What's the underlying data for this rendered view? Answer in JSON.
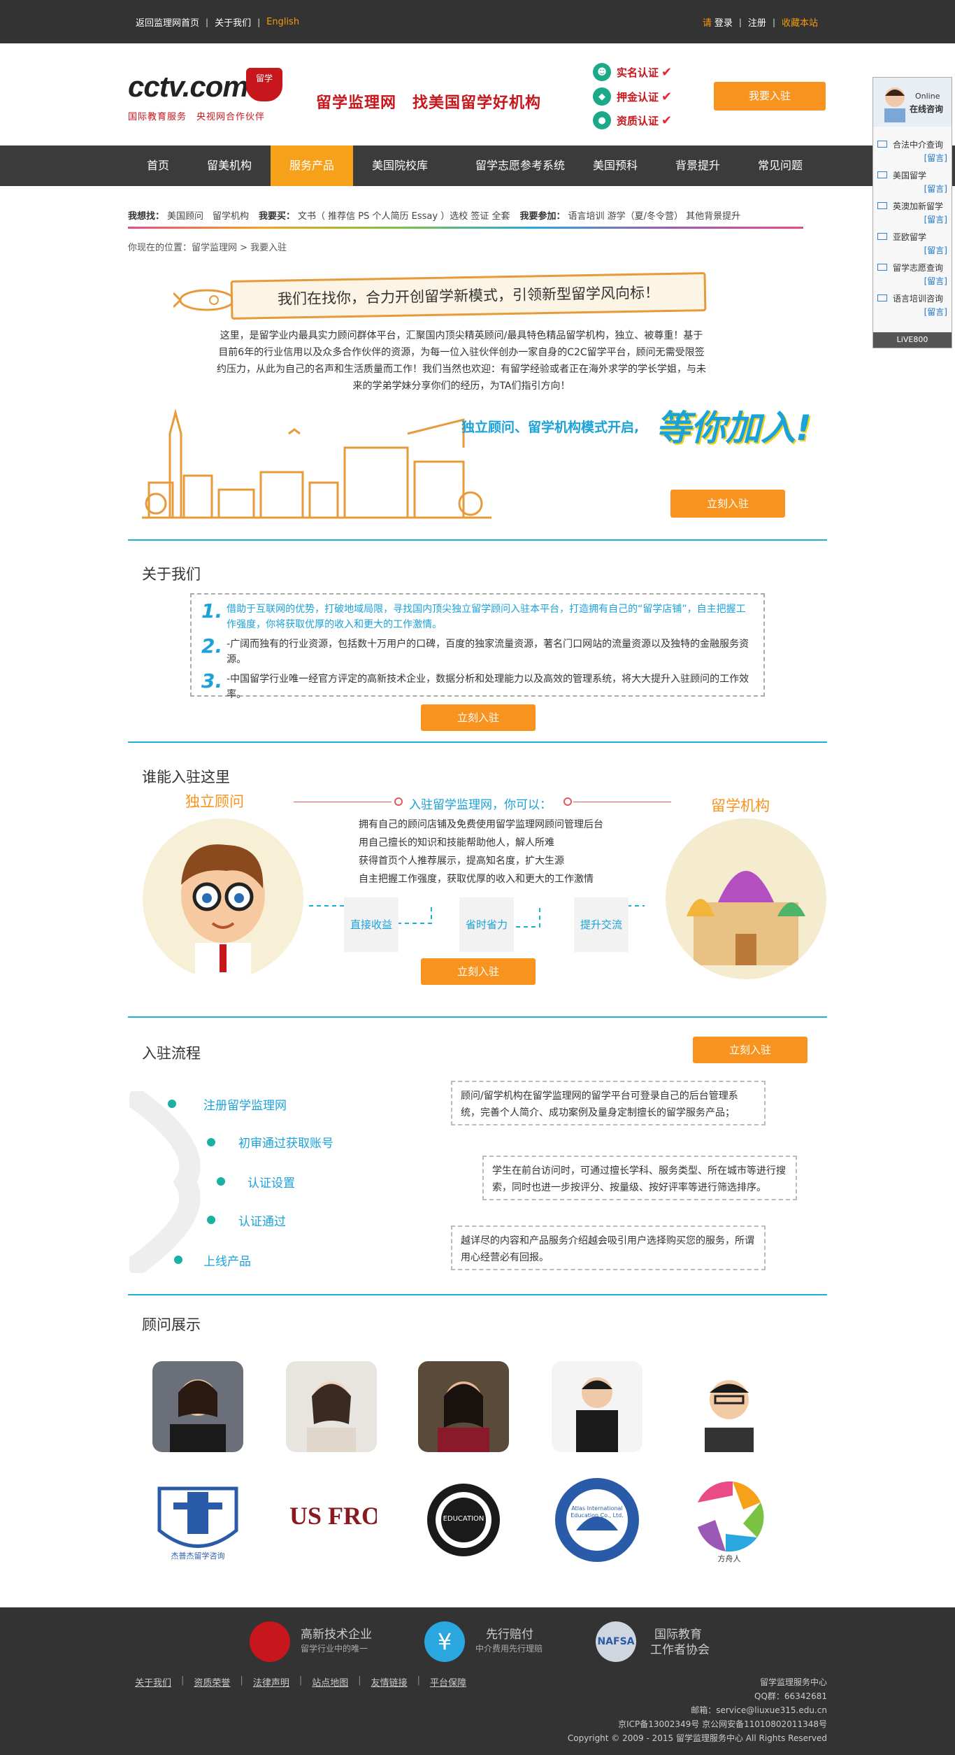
{
  "topbar": {
    "home_link": "返回监理网首页",
    "about_link": "关于我们",
    "english_link": "English",
    "please": "请",
    "login": "登录",
    "register": "注册",
    "bookmark": "收藏本站"
  },
  "header": {
    "logo_text": "cctv.com",
    "logo_sub": "国际教育服务　央视网合作伙伴",
    "badge_text": "留学",
    "slogan": "留学监理网　找美国留学好机构",
    "certs": [
      "实名认证",
      "押金认证",
      "资质认证"
    ],
    "join_button": "我要入驻"
  },
  "nav": {
    "items": [
      "首页",
      "留美机构",
      "服务产品",
      "美国院校库",
      "留学志愿参考系统",
      "美国预科",
      "背景提升",
      "常见问题"
    ]
  },
  "search": {
    "find_label": "我想找：",
    "find_values": "美国顾问　留学机构",
    "buy_label": "我要买：",
    "buy_values": "文书（ 推荐信  PS  个人简历  Essay ）选校  签证  全套",
    "join_label": "我要参加：",
    "join_values": "语言培训  游学（夏/冬令营） 其他背景提升"
  },
  "breadcrumb": "你现在的位置：留学监理网 > 我要入驻",
  "hero": {
    "banner_text": "我们在找你，合力开创留学新模式，引领新型留学风向标！",
    "intro": "这里，是留学业内最具实力顾问群体平台，汇聚国内顶尖精英顾问/最具特色精品留学机构，独立、被尊重！基于目前6年的行业信用以及众多合作伙伴的资源，为每一位入驻伙伴创办一家自身的C2C留学平台，顾问无需受限签约压力，从此为自己的名声和生活质量而工作！我们当然也欢迎：有留学经验或者正在海外求学的学长学姐，与未来的学弟学妹分享你们的经历，为TA们指引方向！",
    "slogan": "独立顾问、留学机构模式开启,",
    "big": "等你加入!",
    "join_button": "立刻入驻"
  },
  "about": {
    "title": "关于我们",
    "items": [
      {
        "num": "1.",
        "text": "借助于互联网的优势，打破地域局限，寻找国内顶尖独立留学顾问入驻本平台，打造拥有自己的“留学店铺”，自主把握工作强度，你将获取优厚的收入和更大的工作激情。"
      },
      {
        "num": "2.",
        "text": "-广阔而独有的行业资源，包括数十万用户的口碑，百度的独家流量资源，著名门口网站的流量资源以及独特的金融服务资源。"
      },
      {
        "num": "3.",
        "text": "-中国留学行业唯一经官方评定的高新技术企业，数据分析和处理能力以及高效的管理系统，将大大提升入驻顾问的工作效率。"
      }
    ],
    "join_button": "立刻入驻"
  },
  "who": {
    "title": "谁能入驻这里",
    "left_label": "独立顾问",
    "right_label": "留学机构",
    "mid_title": "入驻留学监理网，你可以：",
    "list": [
      "拥有自己的顾问店铺及免费使用留学监理网顾问管理后台",
      "用自己擅长的知识和技能帮助他人，解人所难",
      "获得首页个人推荐展示，提高知名度，扩大生源",
      "自主把握工作强度，获取优厚的收入和更大的工作激情"
    ],
    "benefits": [
      "直接收益",
      "省时省力",
      "提升交流"
    ],
    "join_button": "立刻入驻"
  },
  "flow": {
    "title": "入驻流程",
    "join_button": "立刻入驻",
    "steps": [
      "注册留学监理网",
      "初审通过获取账号",
      "认证设置",
      "认证通过",
      "上线产品"
    ],
    "boxes": [
      "顾问/留学机构在留学监理网的留学平台可登录自己的后台管理系统，完善个人简介、成功案例及量身定制擅长的留学服务产品；",
      "学生在前台访问时，可通过擅长学科、服务类型、所在城市等进行搜索，同时也进一步按评分、按量级、按好评率等进行筛选排序。",
      "越详尽的内容和产品服务介绍越会吸引用户选择购买您的服务，所谓用心经营必有回报。"
    ]
  },
  "advisors": {
    "title": "顾问展示",
    "logos": [
      "杰普杰留学咨询",
      "US FRONTIER STUDIO",
      "EDUCATION",
      "Atlas International Education Co., Ltd.",
      "方舟人"
    ]
  },
  "footer": {
    "badges": [
      {
        "title": "高新技术企业",
        "sub": "留学行业中的唯一"
      },
      {
        "title": "先行赔付",
        "sub": "中介费用先行理赔"
      },
      {
        "title": "国际教育",
        "sub": "工作者协会"
      }
    ],
    "links": [
      "关于我们",
      "资质荣誉",
      "法律声明",
      "站点地图",
      "友情链接",
      "平台保障"
    ],
    "info": [
      "留学监理服务中心",
      "QQ群：66342681",
      "邮箱：service@liuxue315.edu.cn",
      "京ICP备13002349号 京公网安备11010802011348号",
      "Copyright © 2009 - 2015 留学监理服务中心 All Rights Reserved"
    ]
  },
  "float": {
    "online": "Online",
    "online_cn": "在线咨询",
    "items": [
      "合法中介查询",
      "美国留学",
      "英澳加新留学",
      "亚欧留学",
      "留学志愿查询",
      "语言培训咨询"
    ],
    "msg": "[留言]",
    "live": "LiVE800"
  },
  "colors": {
    "accent": "#f7931e",
    "teal": "#1ab1d2",
    "blue": "#1aa2d9",
    "red": "#c8161d"
  }
}
